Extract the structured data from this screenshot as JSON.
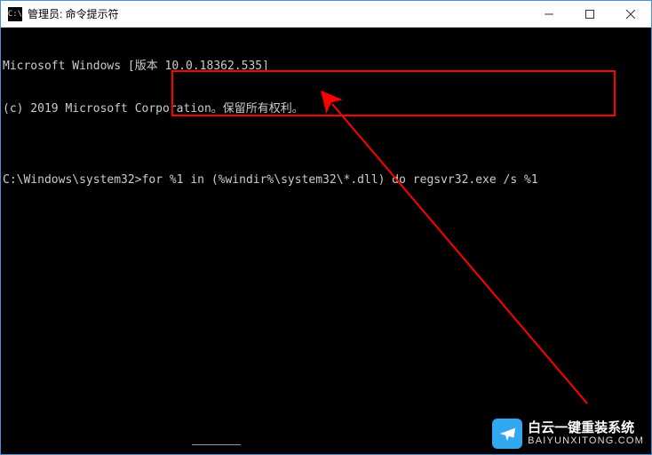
{
  "titlebar": {
    "icon_label": "C:\\",
    "title": "管理员: 命令提示符"
  },
  "window_controls": {
    "minimize": "minimize",
    "maximize": "maximize",
    "close": "close"
  },
  "console": {
    "line1": "Microsoft Windows [版本 10.0.18362.535]",
    "line2": "(c) 2019 Microsoft Corporation。保留所有权利。",
    "blank": "",
    "prompt": "C:\\Windows\\system32>",
    "command": "for %1 in (%windir%\\system32\\*.dll) do regsvr32.exe /s %1"
  },
  "watermark": {
    "title": "白云一键重装系统",
    "url": "BAIYUNXITONG.COM"
  }
}
